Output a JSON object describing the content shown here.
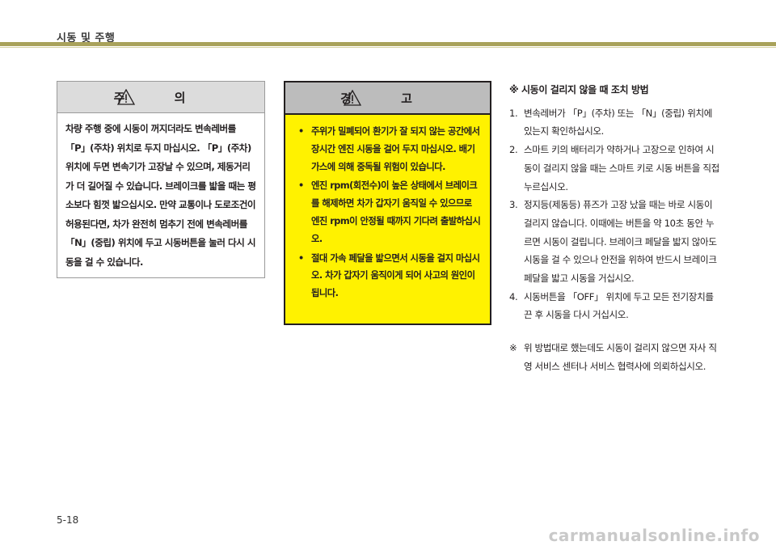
{
  "header": {
    "title": "시동 및 주행"
  },
  "caution": {
    "title": "주 의",
    "text": "차량 주행 중에 시동이 꺼지더라도 변속레버를 「P」(주차) 위치로 두지 마십시오. 「P」(주차) 위치에 두면 변속기가 고장날 수 있으며, 제동거리가 더 길어질 수 있습니다. 브레이크를 밟을 때는 평소보다 힘껏 밟으십시오. 만약 교통이나 도로조건이 허용된다면, 차가 완전히 멈추기 전에 변속레버를 「N」(중립) 위치에 두고 시동버튼을 눌러 다시 시동을 걸 수 있습니다."
  },
  "warning": {
    "title": "경 고",
    "bullet": "•",
    "items": [
      "주위가 밀폐되어 환기가 잘 되지 않는 공간에서 장시간 엔진 시동을 걸어 두지 마십시오. 배기가스에 의해 중독될 위험이 있습니다.",
      "엔진 rpm(회전수)이 높은 상태에서 브레이크를 해제하면 차가 갑자기 움직일 수 있으므로 엔진 rpm이 안정될 때까지 기다려 출발하십시오.",
      "절대 가속 페달을 밟으면서 시동을 걸지 마십시오. 차가 갑자기 움직이게 되어 사고의 원인이 됩니다."
    ]
  },
  "right": {
    "heading": "※ 시동이 걸리지 않을 때 조치 방법",
    "steps": [
      {
        "num": "1.",
        "text": "변속레버가 「P」(주차) 또는 「N」(중립) 위치에 있는지 확인하십시오."
      },
      {
        "num": "2.",
        "text": "스마트 키의 배터리가 약하거나 고장으로 인하여 시동이 걸리지 않을 때는 스마트 키로 시동 버튼을 직접 누르십시오."
      },
      {
        "num": "3.",
        "text": "정지등(제동등) 퓨즈가 고장 났을 때는 바로 시동이 걸리지 않습니다. 이때에는 버튼을 약 10초 동안 누르면 시동이 걸립니다. 브레이크 페달을 밟지 않아도 시동을 걸 수 있으나 안전을 위하여 반드시 브레이크 페달을 밟고 시동을 거십시오."
      },
      {
        "num": "4.",
        "text": "시동버튼을 「OFF」 위치에 두고 모든 전기장치를 끈 후 시동을 다시 거십시오."
      }
    ],
    "note_mark": "※",
    "note": "위 방법대로 했는데도 시동이 걸리지 않으면 자사 직영 서비스 센터나 서비스 협력사에 의뢰하십시오."
  },
  "page_number": "5-18",
  "watermark": "carmanualsonline.info",
  "colors": {
    "header_rule": "#a9a25a",
    "warning_bg": "#fff200",
    "caution_head": "#dcdcdc",
    "warning_head": "#bcbcbc"
  },
  "icons": {
    "caution_icon": "warning-triangle-icon",
    "warning_icon": "warning-triangle-icon"
  }
}
